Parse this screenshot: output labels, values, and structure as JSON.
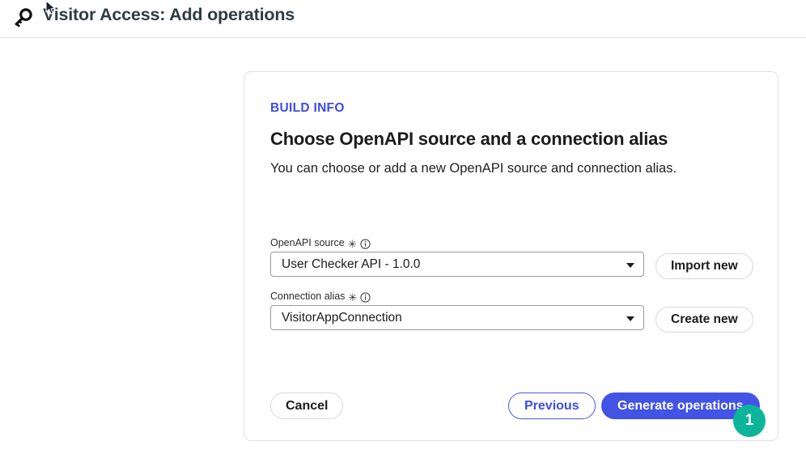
{
  "header": {
    "icon": "key-icon",
    "title": "Visitor Access: Add operations"
  },
  "cursor": {
    "icon": "mouse-pointer-icon"
  },
  "card": {
    "eyebrow": "BUILD INFO",
    "heading": "Choose OpenAPI source and a connection alias",
    "description": "You can choose or add a new OpenAPI source and connection alias.",
    "fields": [
      {
        "label": "OpenAPI source",
        "required_marker": "✳",
        "info_icon": "info-circle-icon",
        "value": "User Checker API - 1.0.0",
        "action_label": "Import new"
      },
      {
        "label": "Connection alias",
        "required_marker": "✳",
        "info_icon": "info-circle-icon",
        "value": "VisitorAppConnection",
        "action_label": "Create new"
      }
    ],
    "footer": {
      "cancel_label": "Cancel",
      "previous_label": "Previous",
      "generate_label": "Generate operations"
    }
  },
  "badge": {
    "step_number": "1"
  },
  "colors": {
    "accent_blue": "#4353e4",
    "badge_teal": "#0cb59a",
    "title_dark": "#2e3d42",
    "card_border": "#e0e2e4"
  }
}
